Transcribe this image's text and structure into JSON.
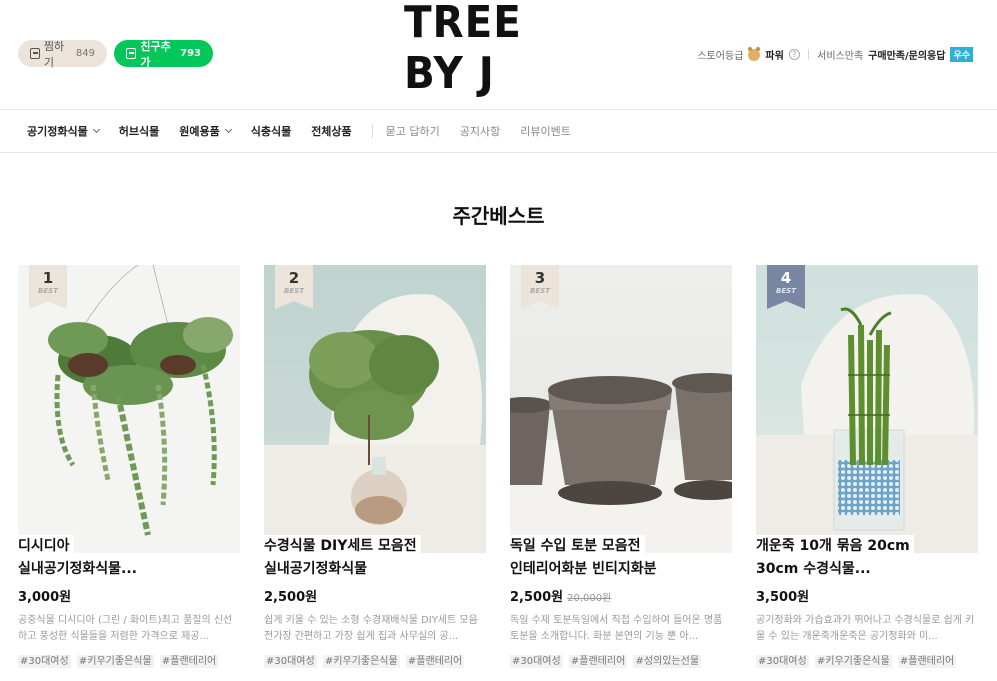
{
  "header": {
    "zzim": {
      "label": "찜하기",
      "count": "849"
    },
    "friend": {
      "label": "친구추가",
      "count": "793"
    },
    "logo": "TREE BY J",
    "store": {
      "grade_label": "스토어등급",
      "grade_value": "파워",
      "service_label": "서비스만족",
      "service_value": "구매만족/문의응답",
      "badge": "우수"
    }
  },
  "nav": {
    "items": [
      {
        "label": "공기정화식물",
        "dropdown": true
      },
      {
        "label": "허브식물",
        "dropdown": false
      },
      {
        "label": "원예용품",
        "dropdown": true
      },
      {
        "label": "식충식물",
        "dropdown": false
      },
      {
        "label": "전체상품",
        "dropdown": false
      }
    ],
    "sub_items": [
      "묻고 답하기",
      "공지사항",
      "리뷰이벤트"
    ]
  },
  "section_title": "주간베스트",
  "products": [
    {
      "rank": "1",
      "best": "BEST",
      "name_line1": "디시디아",
      "name_line2": "실내공기정화식물...",
      "price": "3,000원",
      "original_price": "",
      "desc": "공중식물 디시디아 (그린 / 화이트)최고 품질의 신선하고 풍성한 식물들을 저렴한 가격으로 제공...",
      "tags": [
        "#30대여성",
        "#키우기좋은식물",
        "#플랜테리어"
      ]
    },
    {
      "rank": "2",
      "best": "BEST",
      "name_line1": "수경식물 DIY세트 모음전",
      "name_line2": "실내공기정화식물",
      "price": "2,500원",
      "original_price": "",
      "desc": "쉽게 키울 수 있는 소형 수경재배식물 DIY세트 모음전가장 간편하고 가장 쉽게 집과 사무실의 공...",
      "tags": [
        "#30대여성",
        "#키우기좋은식물",
        "#플랜테리어"
      ]
    },
    {
      "rank": "3",
      "best": "BEST",
      "name_line1": "독일 수입 토분 모음전",
      "name_line2": "인테리어화분 빈티지화분",
      "price": "2,500원",
      "original_price": "20,000원",
      "desc": "독일 수제 토분독일에서 직접 수입하여 들어온 명품 토분을 소개합니다. 화분 본연의 기능 뿐 아...",
      "tags": [
        "#30대여성",
        "#플랜테리어",
        "#성의있는선물"
      ]
    },
    {
      "rank": "4",
      "best": "BEST",
      "name_line1": "개운죽 10개 묶음 20cm",
      "name_line2": "30cm 수경식물...",
      "price": "3,500원",
      "original_price": "",
      "desc": "공기정화와 가습효과가 뛰어나고 수경식물로 쉽게 키울 수 있는 개운죽개운죽은 공기정화와 미...",
      "tags": [
        "#30대여성",
        "#키우기좋은식물",
        "#플랜테리어"
      ]
    }
  ]
}
